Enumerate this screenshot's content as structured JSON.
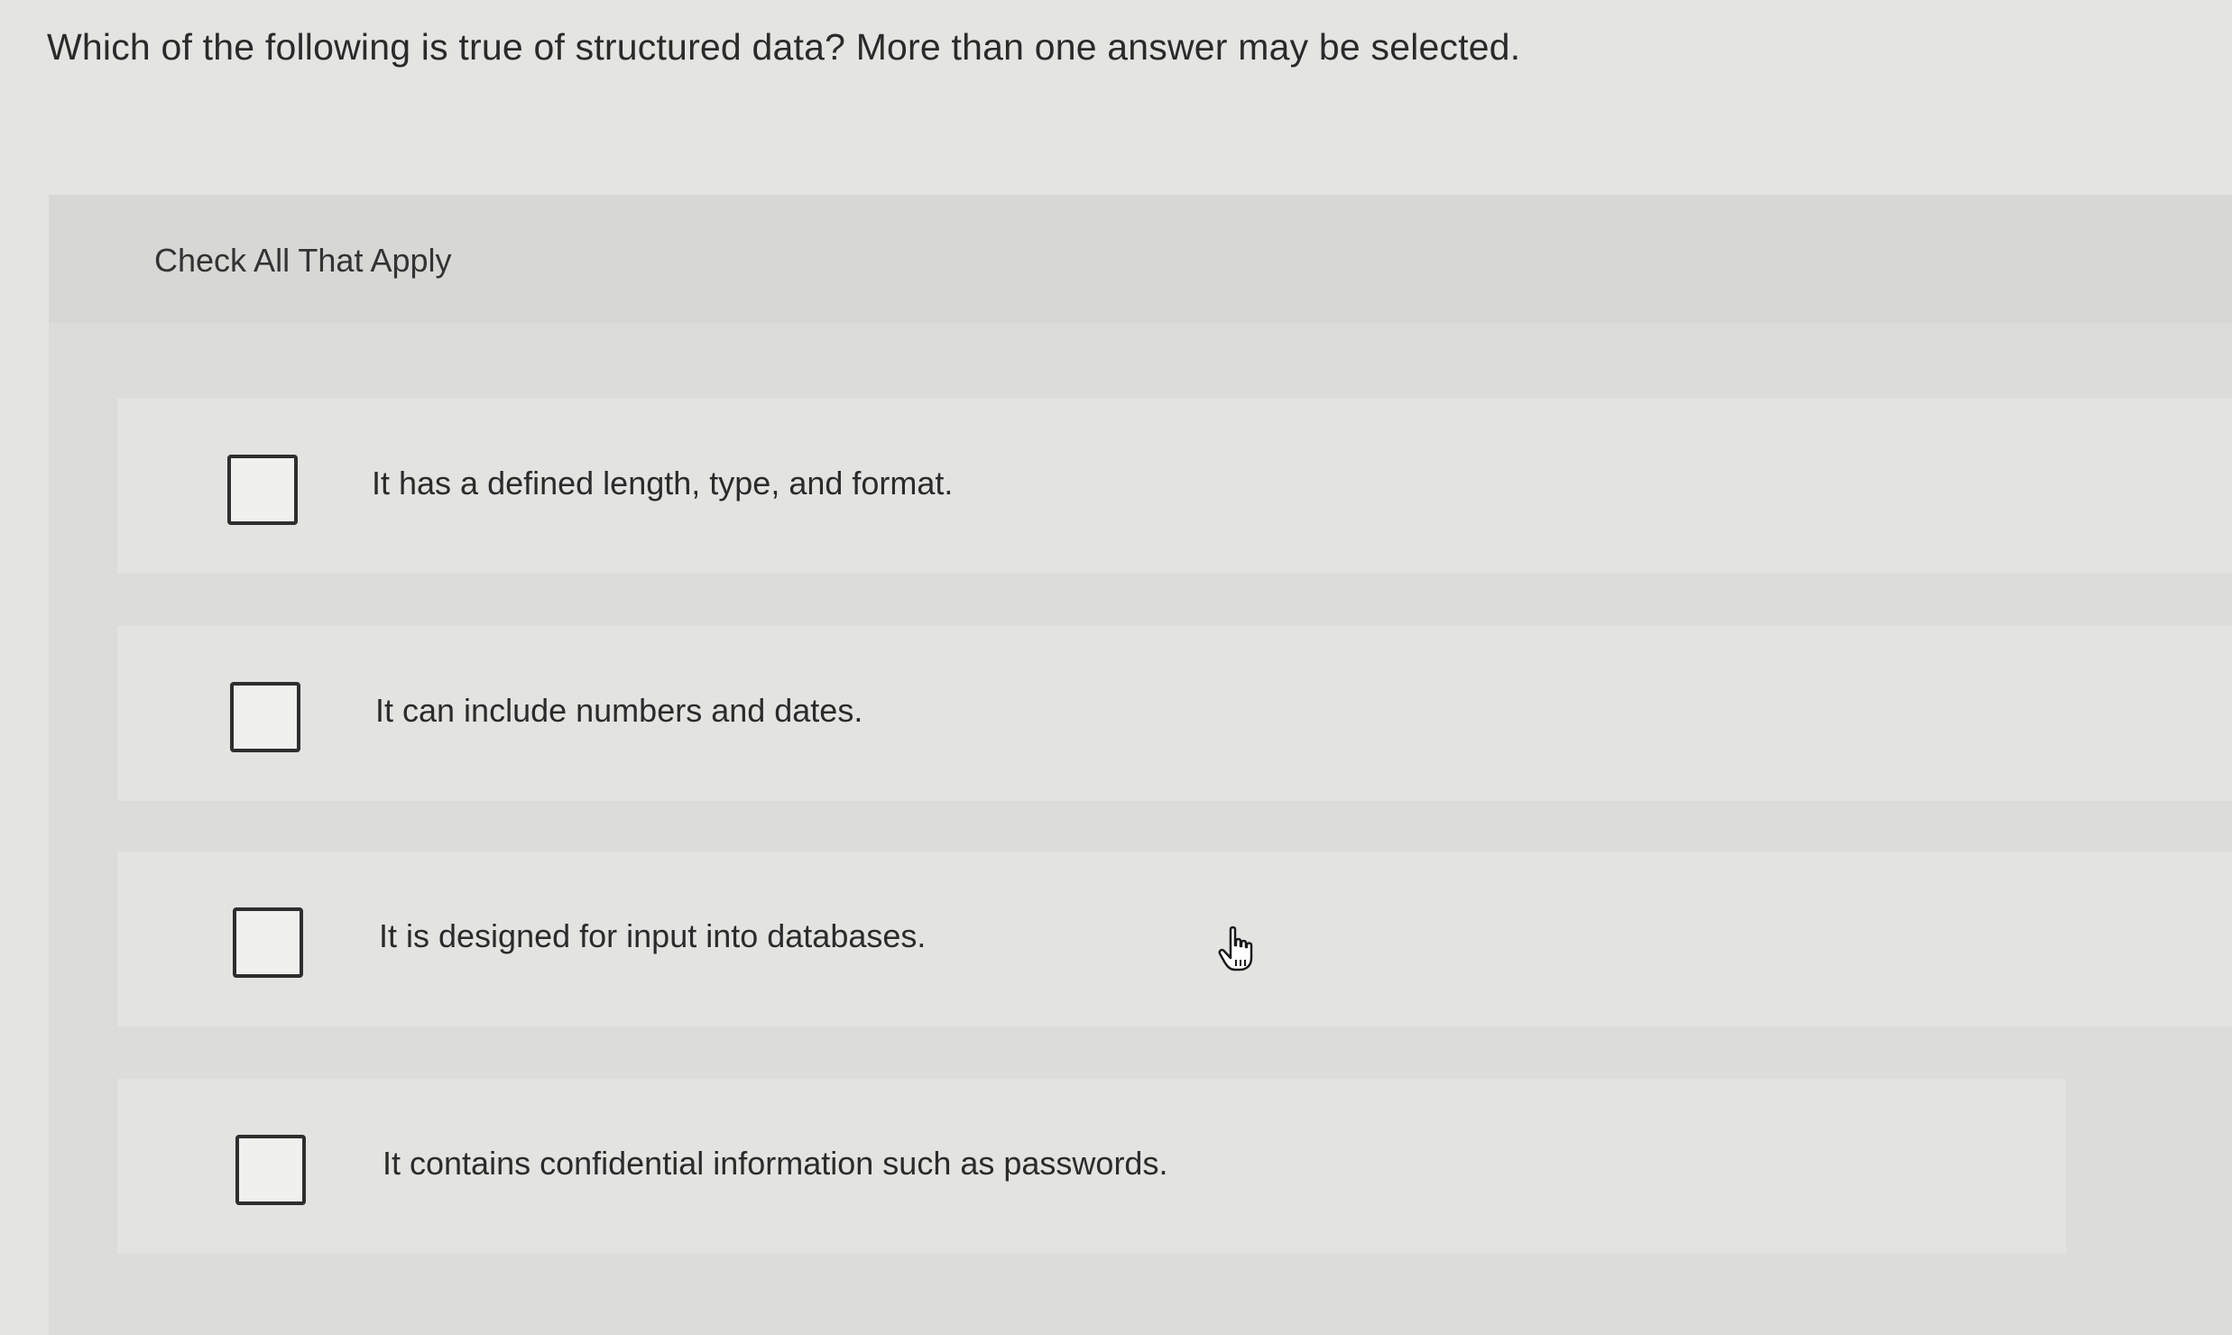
{
  "question": {
    "text": "Which of the following is true of structured data? More than one answer may be selected."
  },
  "panel": {
    "instruction": "Check All That Apply"
  },
  "options": [
    {
      "label": "It has a defined length, type, and format.",
      "checked": false
    },
    {
      "label": "It can include numbers and dates.",
      "checked": false
    },
    {
      "label": "It is designed for input into databases.",
      "checked": false
    },
    {
      "label": "It contains confidential information such as passwords.",
      "checked": false
    }
  ],
  "cursor": {
    "icon": "hand-pointer-icon"
  }
}
